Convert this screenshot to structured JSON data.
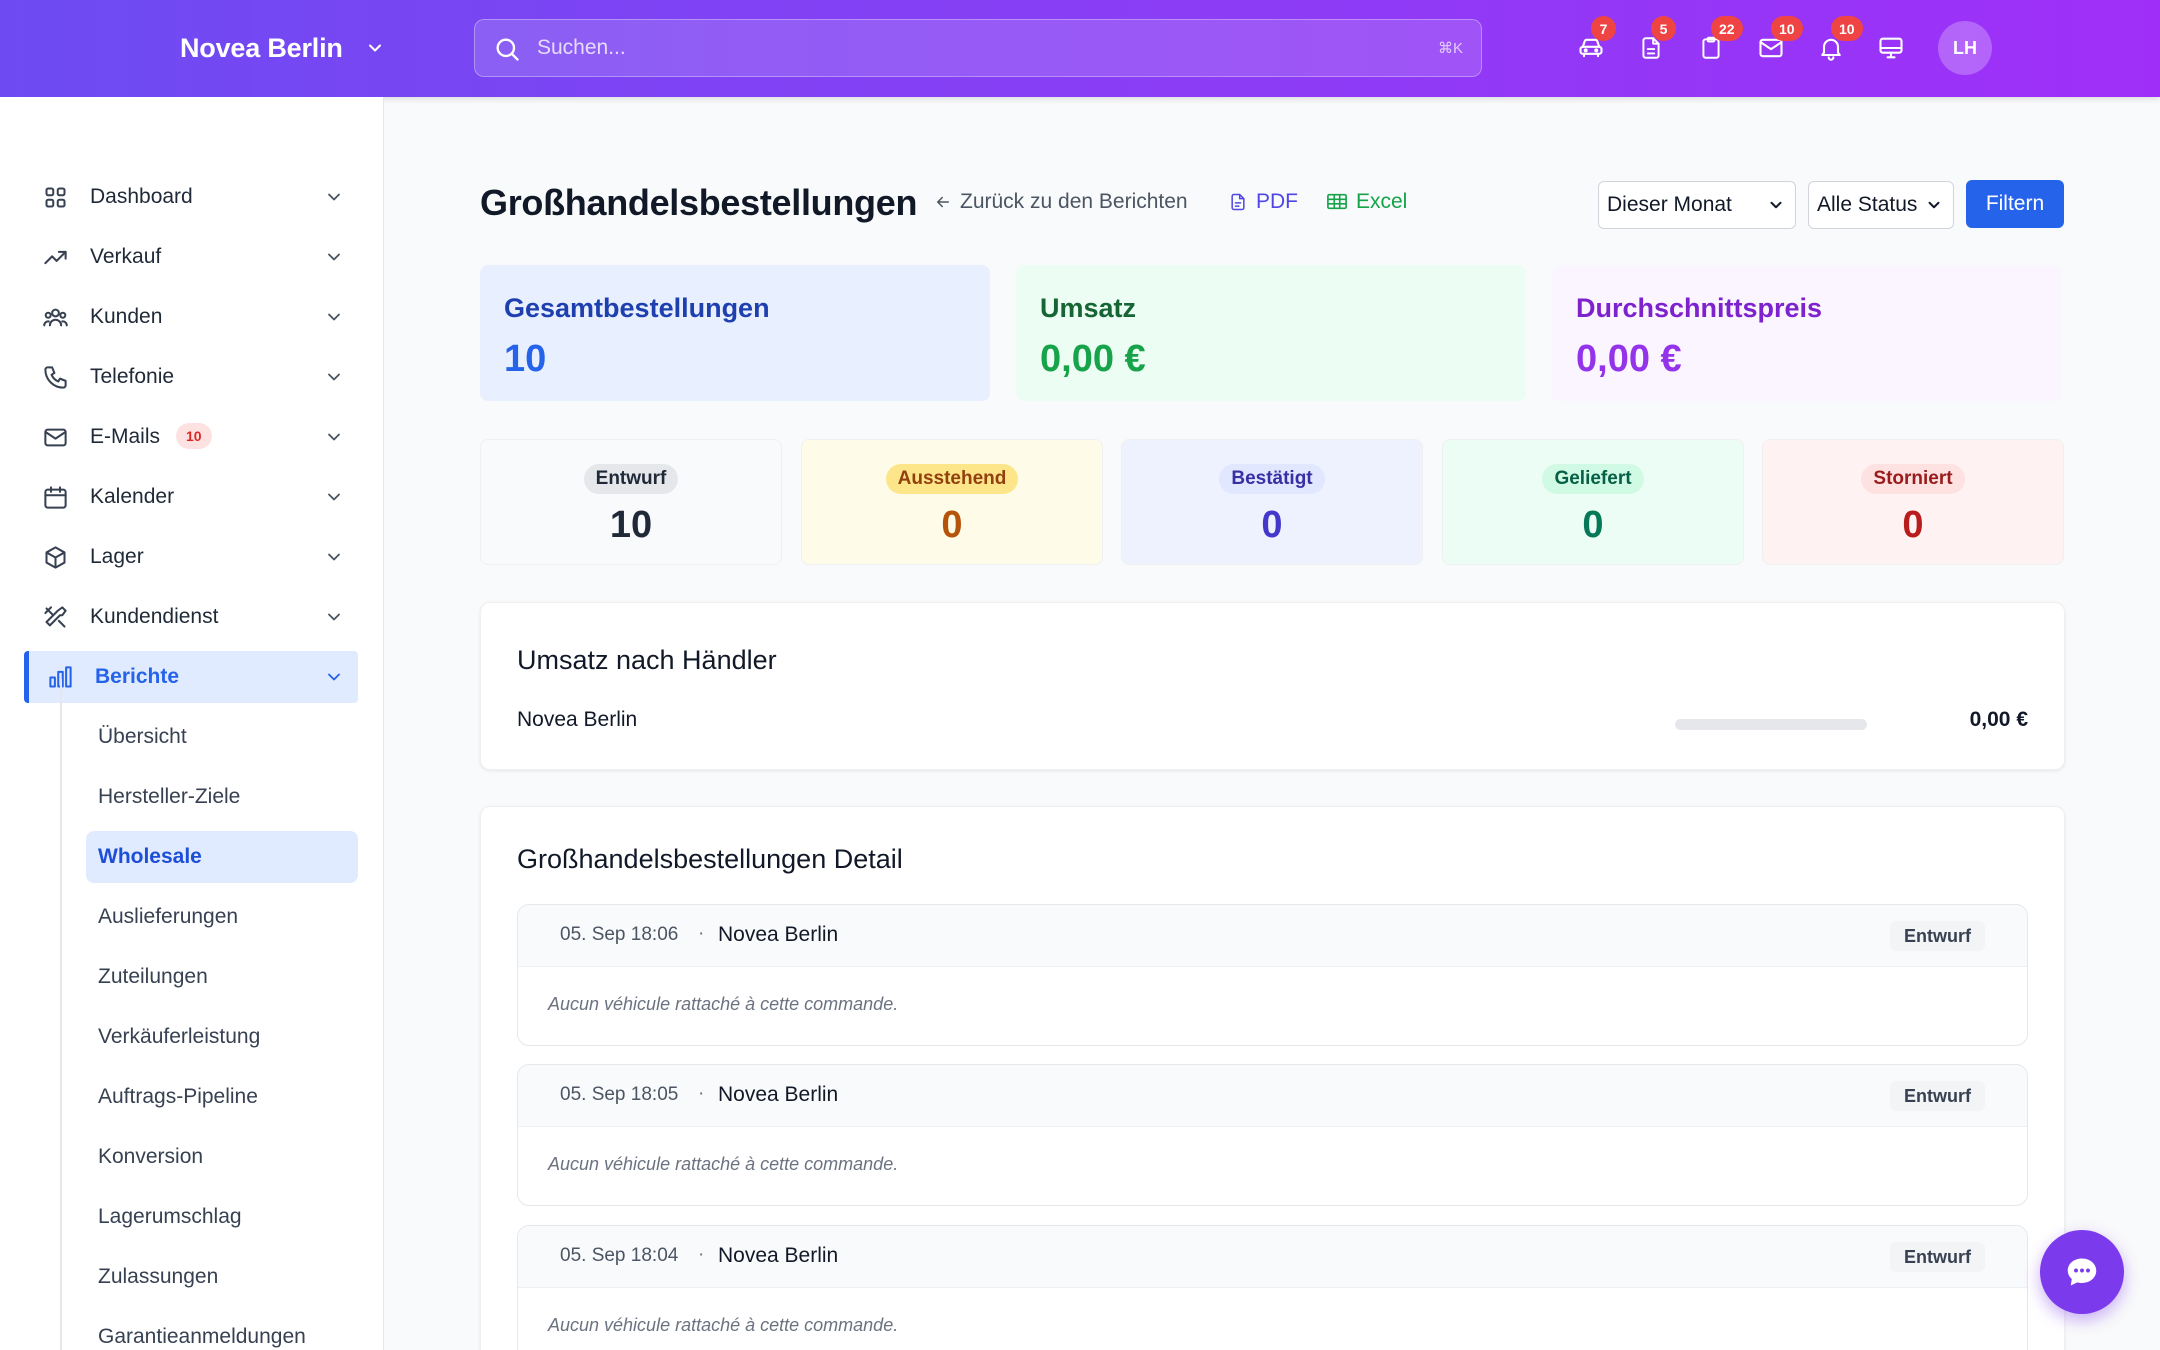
{
  "header": {
    "brand": "Novea Berlin",
    "search_placeholder": "Suchen...",
    "search_shortcut": "⌘K",
    "icons": [
      {
        "name": "car-icon",
        "badge": "7"
      },
      {
        "name": "document-icon",
        "badge": "5"
      },
      {
        "name": "clipboard-icon",
        "badge": "22"
      },
      {
        "name": "mail-icon",
        "badge": "10"
      },
      {
        "name": "bell-icon",
        "badge": "10"
      },
      {
        "name": "monitor-icon",
        "badge": ""
      }
    ],
    "avatar_initials": "LH"
  },
  "sidebar": {
    "items": [
      {
        "label": "Dashboard",
        "icon": "grid-icon"
      },
      {
        "label": "Verkauf",
        "icon": "trending-up-icon"
      },
      {
        "label": "Kunden",
        "icon": "users-icon"
      },
      {
        "label": "Telefonie",
        "icon": "phone-icon"
      },
      {
        "label": "E-Mails",
        "icon": "mail-icon",
        "badge": "10"
      },
      {
        "label": "Kalender",
        "icon": "calendar-icon"
      },
      {
        "label": "Lager",
        "icon": "box-icon"
      },
      {
        "label": "Kundendienst",
        "icon": "tools-icon"
      },
      {
        "label": "Berichte",
        "icon": "bar-chart-icon",
        "active": true
      }
    ],
    "sub_items": [
      {
        "label": "Übersicht"
      },
      {
        "label": "Hersteller-Ziele"
      },
      {
        "label": "Wholesale",
        "active": true
      },
      {
        "label": "Auslieferungen"
      },
      {
        "label": "Zuteilungen"
      },
      {
        "label": "Verkäuferleistung"
      },
      {
        "label": "Auftrags-Pipeline"
      },
      {
        "label": "Konversion"
      },
      {
        "label": "Lagerumschlag"
      },
      {
        "label": "Zulassungen"
      },
      {
        "label": "Garantieanmeldungen"
      }
    ]
  },
  "main": {
    "title": "Großhandelsbestellungen",
    "back_link": "Zurück zu den Berichten",
    "pdf_label": "PDF",
    "excel_label": "Excel",
    "period_select": "Dieser Monat",
    "status_select": "Alle Status",
    "filter_button": "Filtern",
    "kpis": [
      {
        "label": "Gesamtbestellungen",
        "value": "10",
        "bg": "#e8efff",
        "color": "#1e40af",
        "value_color": "#2563eb"
      },
      {
        "label": "Umsatz",
        "value": "0,00 €",
        "bg": "#ecfdf3",
        "color": "#166534",
        "value_color": "#16a34a"
      },
      {
        "label": "Durchschnittspreis",
        "value": "0,00 €",
        "bg": "#faf5ff",
        "color": "#7e22ce",
        "value_color": "#9333ea"
      }
    ],
    "status_counts": [
      {
        "label": "Entwurf",
        "value": "10",
        "bg": "#f9fafb",
        "pill_bg": "#e5e7eb",
        "pill_color": "#1f2937",
        "value_color": "#1f2937"
      },
      {
        "label": "Ausstehend",
        "value": "0",
        "bg": "#fefce8",
        "pill_bg": "#fde68a",
        "pill_color": "#92400e",
        "value_color": "#b45309"
      },
      {
        "label": "Bestätigt",
        "value": "0",
        "bg": "#eef2ff",
        "pill_bg": "#e0e7ff",
        "pill_color": "#3730a3",
        "value_color": "#4338ca"
      },
      {
        "label": "Geliefert",
        "value": "0",
        "bg": "#ecfdf5",
        "pill_bg": "#d1fae5",
        "pill_color": "#065f46",
        "value_color": "#047857"
      },
      {
        "label": "Storniert",
        "value": "0",
        "bg": "#fef2f2",
        "pill_bg": "#fee2e2",
        "pill_color": "#991b1b",
        "value_color": "#b91c1c"
      }
    ],
    "dealer_section": {
      "title": "Umsatz nach Händler",
      "rows": [
        {
          "name": "Novea Berlin",
          "value": "0,00 €",
          "share": 0
        }
      ]
    },
    "detail_section": {
      "title": "Großhandelsbestellungen Detail",
      "orders": [
        {
          "date": "05. Sep 18:06",
          "dealer": "Novea Berlin",
          "status": "Entwurf",
          "note": "Aucun véhicule rattaché à cette commande."
        },
        {
          "date": "05. Sep 18:05",
          "dealer": "Novea Berlin",
          "status": "Entwurf",
          "note": "Aucun véhicule rattaché à cette commande."
        },
        {
          "date": "05. Sep 18:04",
          "dealer": "Novea Berlin",
          "status": "Entwurf",
          "note": "Aucun véhicule rattaché à cette commande."
        }
      ]
    }
  },
  "colors": {
    "primary": "#2563eb",
    "header_gradient_start": "#6d4bf2",
    "header_gradient_end": "#9f2ff8",
    "chat_fab": "#7c3aed"
  }
}
